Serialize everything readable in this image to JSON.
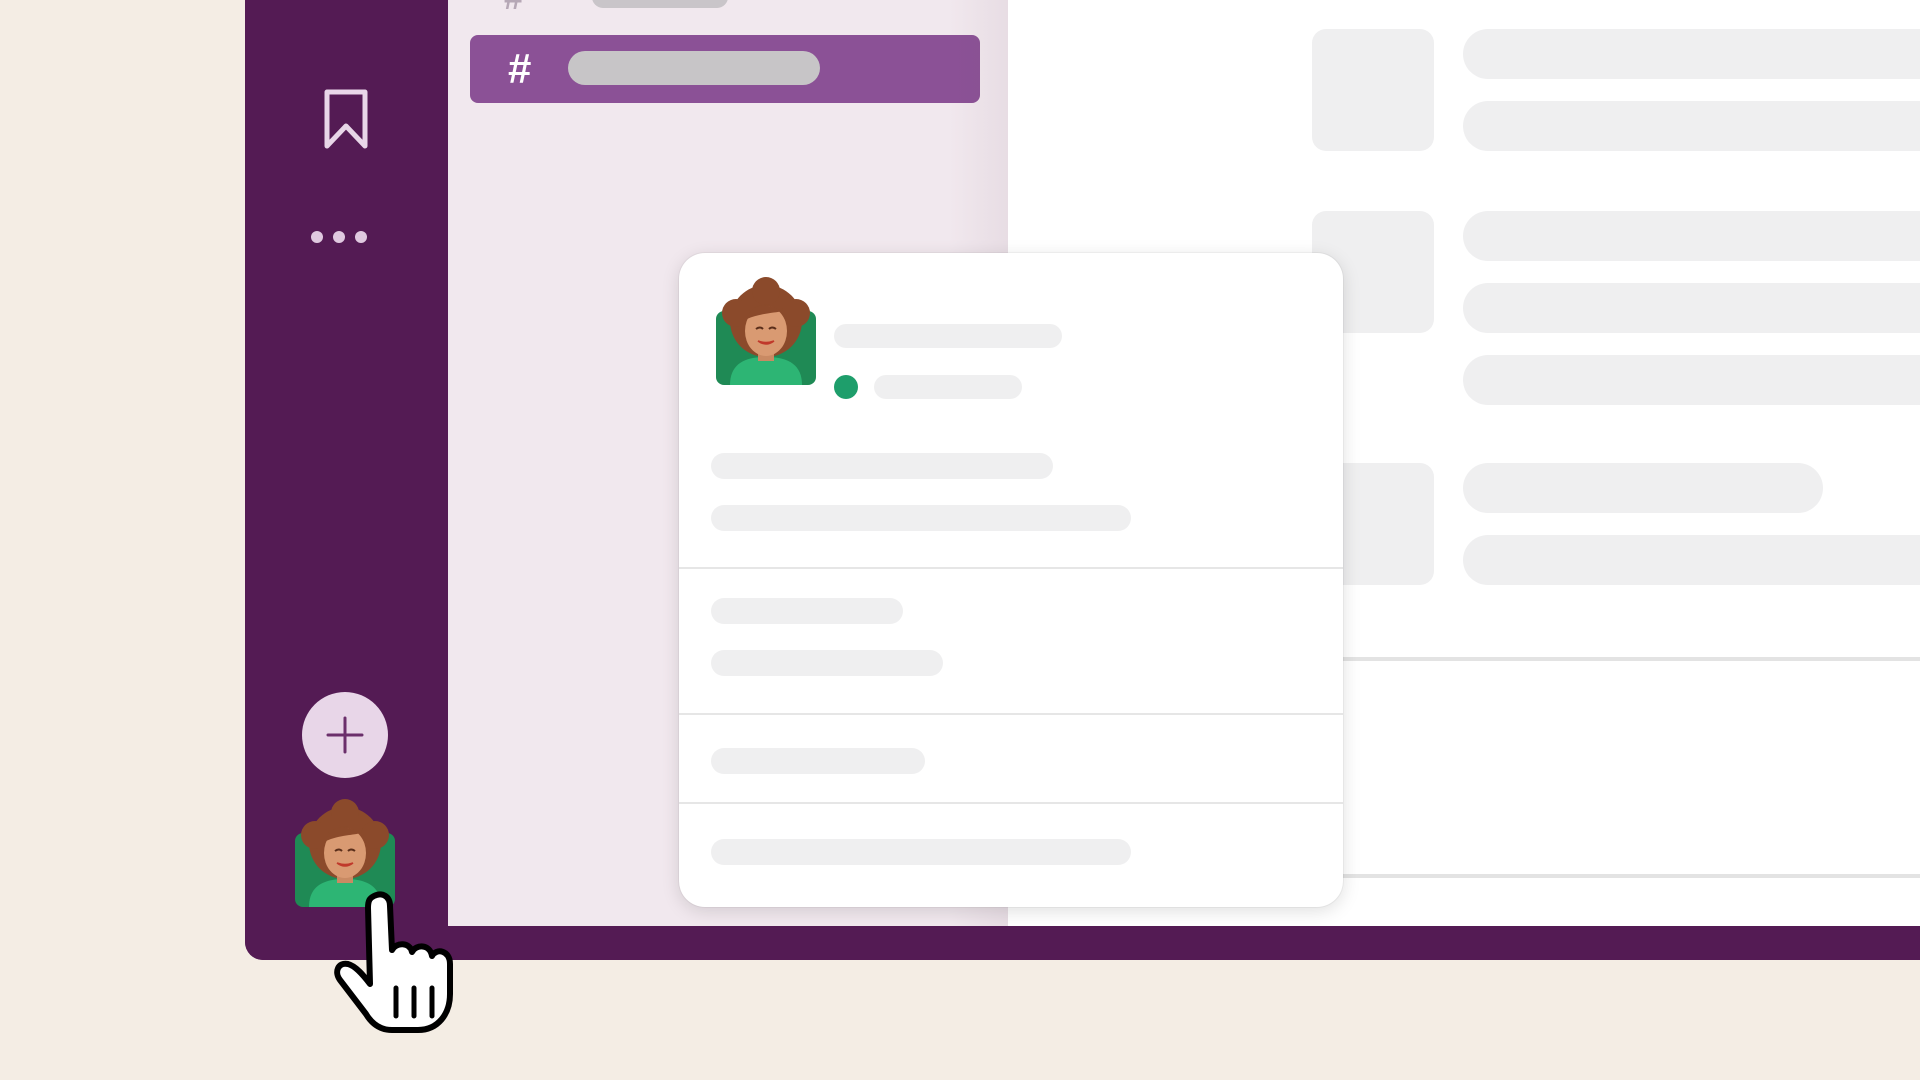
{
  "sidebar": {
    "channel_prefix": "#",
    "active_channel_prefix": "#"
  },
  "rail": {
    "icons": [
      "bookmark-icon",
      "more-icon",
      "plus-icon"
    ]
  },
  "presence": {
    "status": "active",
    "color": "#1E9E6B"
  },
  "colors": {
    "workspace": "#541B54",
    "active_channel": "#8B5196",
    "background": "#F4EDE4"
  }
}
